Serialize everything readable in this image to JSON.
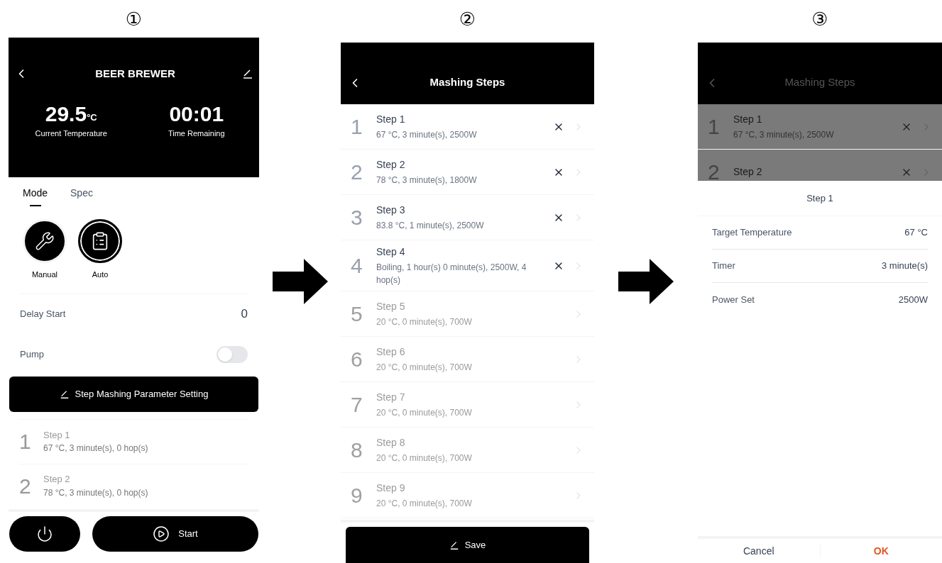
{
  "screen_1": {
    "label": "①",
    "title": "BEER BREWER",
    "temperature": "29.5",
    "temperature_unit": "°C",
    "temperature_label": "Current Temperature",
    "time": "00:01",
    "time_label": "Time Remaining",
    "tabs": [
      {
        "label": "Mode",
        "selected": true
      },
      {
        "label": "Spec",
        "selected": false
      }
    ],
    "modes": [
      {
        "kind": "manual",
        "label": "Manual",
        "selected": false
      },
      {
        "kind": "auto",
        "label": "Auto",
        "selected": true
      }
    ],
    "delay_start": {
      "label": "Delay Start",
      "value": "0"
    },
    "pump": {
      "label": "Pump",
      "on": false
    },
    "setting_button": "Step Mashing Parameter Setting",
    "steps": [
      {
        "number": "1",
        "title": "Step 1",
        "detail": "67 °C, 3 minute(s), 0 hop(s)"
      },
      {
        "number": "2",
        "title": "Step 2",
        "detail": "78 °C, 3 minute(s), 0 hop(s)"
      }
    ],
    "start_button": "Start"
  },
  "screen_2": {
    "label": "②",
    "title": "Mashing Steps",
    "steps": [
      {
        "number": "1",
        "title": "Step 1",
        "detail": "67 °C, 3 minute(s), 2500W",
        "enabled": true
      },
      {
        "number": "2",
        "title": "Step 2",
        "detail": "78 °C, 3 minute(s), 1800W",
        "enabled": true
      },
      {
        "number": "3",
        "title": "Step 3",
        "detail": "83.8 °C, 1 minute(s), 2500W",
        "enabled": true
      },
      {
        "number": "4",
        "title": "Step 4",
        "detail": "Boiling, 1 hour(s) 0 minute(s), 2500W, 4 hop(s)",
        "enabled": true
      },
      {
        "number": "5",
        "title": "Step 5",
        "detail": "20 °C, 0 minute(s), 700W",
        "enabled": false
      },
      {
        "number": "6",
        "title": "Step 6",
        "detail": "20 °C, 0 minute(s), 700W",
        "enabled": false
      },
      {
        "number": "7",
        "title": "Step 7",
        "detail": "20 °C, 0 minute(s), 700W",
        "enabled": false
      },
      {
        "number": "8",
        "title": "Step 8",
        "detail": "20 °C, 0 minute(s), 700W",
        "enabled": false
      },
      {
        "number": "9",
        "title": "Step 9",
        "detail": "20 °C, 0 minute(s), 700W",
        "enabled": false
      }
    ],
    "save_button": "Save"
  },
  "screen_3": {
    "label": "③",
    "title": "Mashing Steps",
    "steps": [
      {
        "number": "1",
        "title": "Step 1",
        "detail": "67 °C, 3 minute(s), 2500W",
        "enabled": true
      },
      {
        "number": "2",
        "title": "Step 2",
        "enabled": true
      }
    ],
    "sheet": {
      "title": "Step 1",
      "rows": [
        {
          "label": "Target Temperature",
          "value": "67 °C"
        },
        {
          "label": "Timer",
          "value": "3 minute(s)"
        },
        {
          "label": "Power Set",
          "value": "2500W"
        }
      ],
      "cancel": "Cancel",
      "ok": "OK"
    }
  }
}
